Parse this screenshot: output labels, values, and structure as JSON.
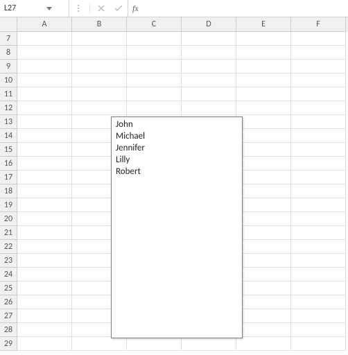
{
  "formula_bar": {
    "name_box": "L27",
    "formula": ""
  },
  "columns": [
    "A",
    "B",
    "C",
    "D",
    "E",
    "F"
  ],
  "rows": [
    "7",
    "8",
    "9",
    "10",
    "11",
    "12",
    "13",
    "14",
    "15",
    "16",
    "17",
    "18",
    "19",
    "20",
    "21",
    "22",
    "23",
    "24",
    "25",
    "26",
    "27",
    "28",
    "29"
  ],
  "listbox": {
    "items": [
      "John",
      "Michael",
      "Jennifer",
      "Lilly",
      "Robert"
    ]
  }
}
